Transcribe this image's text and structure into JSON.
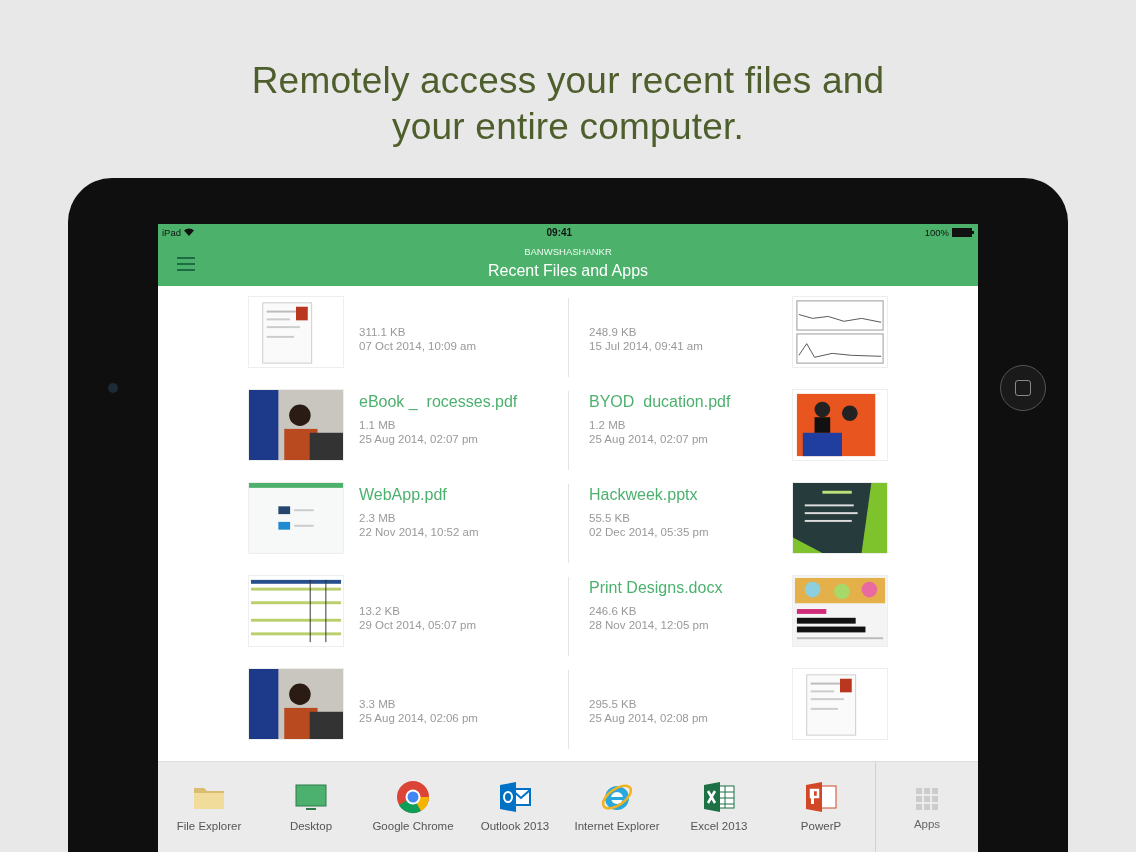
{
  "headline": "Remotely access your recent files and\nyour entire computer.",
  "status_bar": {
    "device": "iPad",
    "time": "09:41",
    "battery": "100%"
  },
  "header": {
    "account": "BANWSHASHANKR",
    "title": "Recent Files and Apps"
  },
  "file_rows": [
    {
      "left": {
        "size": "311.1 KB",
        "date": "07 Oct 2014, 10:09 am"
      },
      "right": {
        "size": "248.9 KB",
        "date": "15 Jul 2014, 09:41 am"
      }
    },
    {
      "left": {
        "name": "eBook _  rocesses.pdf",
        "size": "1.1 MB",
        "date": "25 Aug 2014, 02:07 pm"
      },
      "right": {
        "name": "BYOD  ducation.pdf",
        "size": "1.2 MB",
        "date": "25 Aug 2014, 02:07 pm"
      }
    },
    {
      "left": {
        "name": "WebApp.pdf",
        "size": "2.3 MB",
        "date": "22 Nov 2014, 10:52 am"
      },
      "right": {
        "name": "Hackweek.pptx",
        "size": "55.5 KB",
        "date": "02 Dec 2014, 05:35 pm"
      }
    },
    {
      "left": {
        "size": "13.2 KB",
        "date": "29 Oct 2014, 05:07 pm"
      },
      "right": {
        "name": "Print Designs.docx",
        "size": "246.6 KB",
        "date": "28 Nov 2014, 12:05 pm"
      }
    },
    {
      "left": {
        "size": "3.3 MB",
        "date": "25 Aug 2014, 02:06 pm"
      },
      "right": {
        "size": "295.5 KB",
        "date": "25 Aug 2014, 02:08 pm"
      }
    }
  ],
  "dock": [
    {
      "label": "File Explorer",
      "kind": "folder"
    },
    {
      "label": "Desktop",
      "kind": "monitor"
    },
    {
      "label": "Google Chrome",
      "kind": "chrome"
    },
    {
      "label": "Outlook 2013",
      "kind": "outlook"
    },
    {
      "label": "Internet Explorer",
      "kind": "ie"
    },
    {
      "label": "Excel 2013",
      "kind": "excel"
    },
    {
      "label": "PowerP",
      "kind": "powerpoint"
    }
  ],
  "apps_button": {
    "label": "Apps"
  }
}
